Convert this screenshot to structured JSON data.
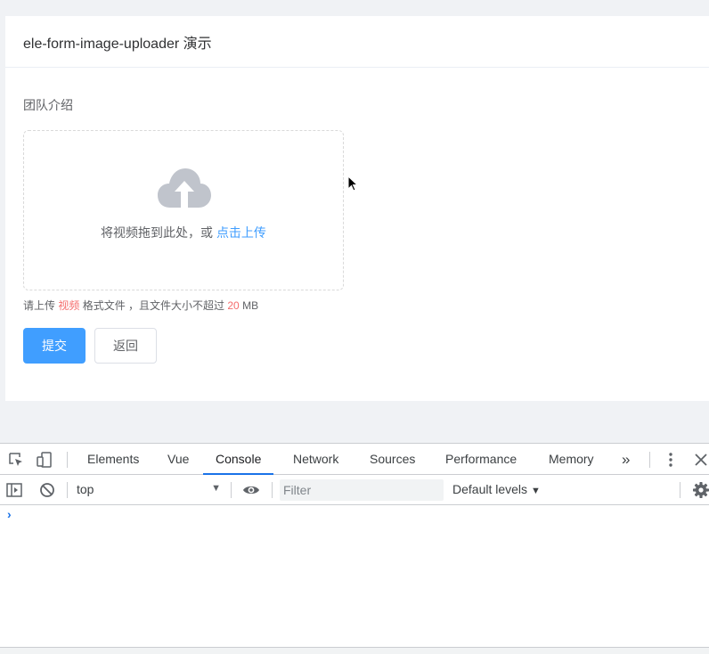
{
  "card": {
    "title": "ele-form-image-uploader 演示",
    "field_label": "团队介绍",
    "dropzone": {
      "icon": "upload-cloud-icon",
      "text": "将视频拖到此处，或 ",
      "link": "点击上传"
    },
    "tip": {
      "prefix": "请上传 ",
      "type": "视频",
      "middle": " 格式文件 ，且文件大小不超过 ",
      "size": "20",
      "suffix": " MB"
    },
    "submit_label": "提交",
    "back_label": "返回"
  },
  "devtools": {
    "tabs": [
      "Elements",
      "Vue",
      "Console",
      "Network",
      "Sources",
      "Performance",
      "Memory"
    ],
    "active_tab": "Console",
    "more_label": "»",
    "context": "top",
    "filter_placeholder": "Filter",
    "levels_label": "Default levels",
    "prompt": "›"
  },
  "colors": {
    "primary": "#409eff",
    "danger": "#f56c6c",
    "devtools_accent": "#1a73e8"
  }
}
